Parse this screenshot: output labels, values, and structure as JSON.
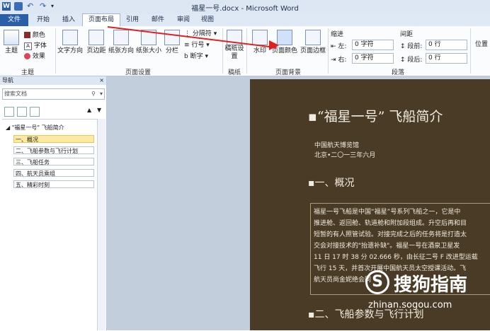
{
  "titlebar": {
    "title": "福星一号.docx - Microsoft Word"
  },
  "tabs": [
    "文件",
    "开始",
    "插入",
    "页面布局",
    "引用",
    "邮件",
    "审阅",
    "视图"
  ],
  "ribbon": {
    "themes": {
      "big": "主题",
      "items": [
        "颜色",
        "字体",
        "效果"
      ],
      "label": "主题"
    },
    "page_setup": {
      "buttons": [
        "文字方向",
        "页边距",
        "纸张方向",
        "纸张大小",
        "分栏"
      ],
      "small": [
        "分隔符",
        "行号",
        "断字"
      ],
      "label": "页面设置"
    },
    "draft": {
      "button": "稿纸设置",
      "label": "稿纸"
    },
    "page_bg": {
      "buttons": [
        "水印",
        "页面颜色",
        "页面边框"
      ],
      "label": "页面背景"
    },
    "paragraph": {
      "indent": "缩进",
      "spacing": "间距",
      "left": "左:",
      "right": "右:",
      "before": "段前:",
      "after": "段后:",
      "left_val": "0 字符",
      "right_val": "0 字符",
      "before_val": "0 行",
      "after_val": "0 行",
      "label": "段落"
    },
    "position": "位置"
  },
  "nav": {
    "header": "导航",
    "search_placeholder": "搜索文档",
    "root": "\"福星一号\" 飞船简介",
    "items": [
      "一、概况",
      "二、飞船参数与飞行计划",
      "三、飞船任务",
      "四、航天员乘组",
      "五、精彩时刻"
    ]
  },
  "doc": {
    "title": "“福星一号” 飞船简介",
    "org": "中国航天博览馆",
    "date": "北京•二〇一三年六月",
    "h1": "一、概况",
    "para": [
      "福星一号飞船是中国“福星”号系列飞船之一，它是中",
      "推进舱、返回舱、轨道舱和附加段组成。升空后再和目",
      "短暂的有人照管试验。对接完成之后的任务将是打造太",
      "交会对接技术的\"抬遗补缺\"。福星一号在酒泉卫星发",
      "11 日 17 时 38 分 02.666 秒，由长征二号 F 改进型运载",
      "飞行 15 天，并首次开展中国航天员太空授课活动。飞",
      "航天员尚金妮绝会同"
    ],
    "h2": "二、飞船参数与飞行计划"
  },
  "watermark": {
    "brand": "搜狗指南",
    "url": "zhinan.sogou.com"
  }
}
